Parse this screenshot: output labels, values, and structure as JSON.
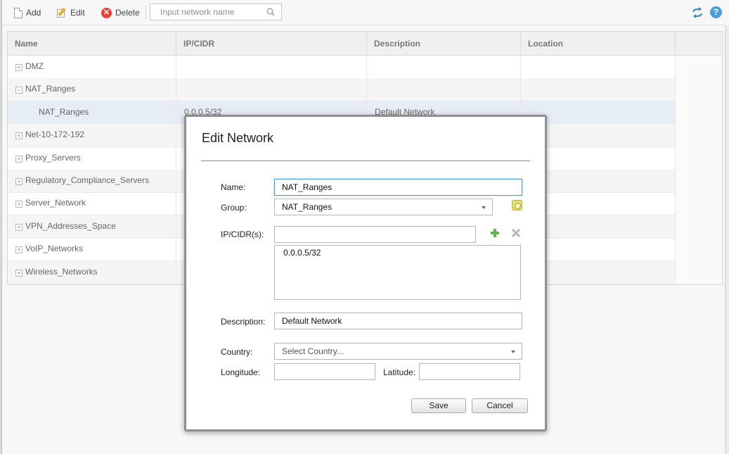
{
  "toolbar": {
    "add_label": "Add",
    "edit_label": "Edit",
    "delete_label": "Delete",
    "search_placeholder": "Input network name",
    "search_value": ""
  },
  "grid": {
    "columns": [
      "Name",
      "IP/CIDR",
      "Description",
      "Location"
    ],
    "rows": [
      {
        "name": "DMZ",
        "ip": "",
        "description": "",
        "location": "",
        "expander": "+"
      },
      {
        "name": "NAT_Ranges",
        "ip": "",
        "description": "",
        "location": "",
        "expander": "−"
      },
      {
        "name": "NAT_Ranges",
        "ip": "0.0.0.5/32",
        "description": "Default Network",
        "location": "",
        "expander": ""
      },
      {
        "name": "Net-10-172-192",
        "ip": "",
        "description": "",
        "location": "",
        "expander": "+"
      },
      {
        "name": "Proxy_Servers",
        "ip": "",
        "description": "",
        "location": "",
        "expander": "+"
      },
      {
        "name": "Regulatory_Compliance_Servers",
        "ip": "",
        "description": "",
        "location": "",
        "expander": "+"
      },
      {
        "name": "Server_Network",
        "ip": "",
        "description": "",
        "location": "",
        "expander": "+"
      },
      {
        "name": "VPN_Addresses_Space",
        "ip": "",
        "description": "",
        "location": "",
        "expander": "+"
      },
      {
        "name": "VoIP_Networks",
        "ip": "",
        "description": "",
        "location": "",
        "expander": "+"
      },
      {
        "name": "Wireless_Networks",
        "ip": "",
        "description": "",
        "location": "",
        "expander": "+"
      }
    ]
  },
  "dialog": {
    "title": "Edit Network",
    "name_label": "Name:",
    "name_value": "NAT_Ranges",
    "group_label": "Group:",
    "group_value": "NAT_Ranges",
    "ip_label": "IP/CIDR(s):",
    "ip_input_value": "",
    "ip_list": [
      "0.0.0.5/32"
    ],
    "description_label": "Description:",
    "description_value": "Default Network",
    "country_label": "Country:",
    "country_value": "Select Country...",
    "longitude_label": "Longitude:",
    "longitude_value": "",
    "latitude_label": "Latitude:",
    "latitude_value": "",
    "save_label": "Save",
    "cancel_label": "Cancel"
  },
  "colors": {
    "delete_red": "#e5413a",
    "help_blue": "#4a9fd8",
    "add_green": "#5fb64a",
    "focus_blue": "#4a9ad6"
  },
  "icons": [
    "add-icon",
    "edit-icon",
    "delete-icon",
    "search-icon",
    "refresh-icon",
    "help-icon",
    "gear-icon",
    "plus-icon",
    "remove-icon"
  ]
}
